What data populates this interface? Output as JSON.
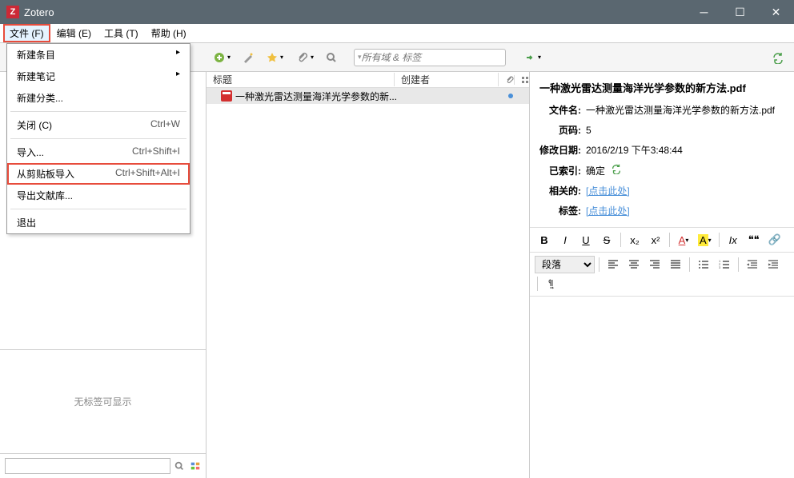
{
  "window": {
    "title": "Zotero"
  },
  "menubar": {
    "file": "文件 (F)",
    "edit": "编辑 (E)",
    "tools": "工具 (T)",
    "help": "帮助 (H)"
  },
  "file_menu": {
    "new_item": "新建条目",
    "new_note": "新建笔记",
    "new_collection": "新建分类...",
    "close": "关闭 (C)",
    "close_key": "Ctrl+W",
    "import": "导入...",
    "import_key": "Ctrl+Shift+I",
    "import_clipboard": "从剪贴板导入",
    "import_clipboard_key": "Ctrl+Shift+Alt+I",
    "export": "导出文献库...",
    "exit": "退出"
  },
  "search": {
    "placeholder": "所有域 & 标签"
  },
  "columns": {
    "title": "标题",
    "creator": "创建者"
  },
  "item": {
    "title": "一种激光雷达测量海洋光学参数的新..."
  },
  "detail": {
    "title": "一种激光雷达测量海洋光学参数的新方法.pdf",
    "filename_label": "文件名:",
    "filename": "一种激光雷达测量海洋光学参数的新方法.pdf",
    "pages_label": "页码:",
    "pages": "5",
    "modified_label": "修改日期:",
    "modified": "2016/2/19 下午3:48:44",
    "indexed_label": "已索引:",
    "indexed": "确定",
    "related_label": "相关的:",
    "related": "[点击此处]",
    "tags_label": "标签:",
    "tags": "[点击此处]"
  },
  "tags_empty": "无标签可显示",
  "editor": {
    "paragraph": "段落",
    "bold": "B",
    "italic": "I",
    "underline": "U",
    "strike": "S",
    "sub": "x₂",
    "sup": "x²",
    "color": "A",
    "bg": "A",
    "clear": "Ix",
    "quote": "❝❝",
    "link": "🔗"
  }
}
